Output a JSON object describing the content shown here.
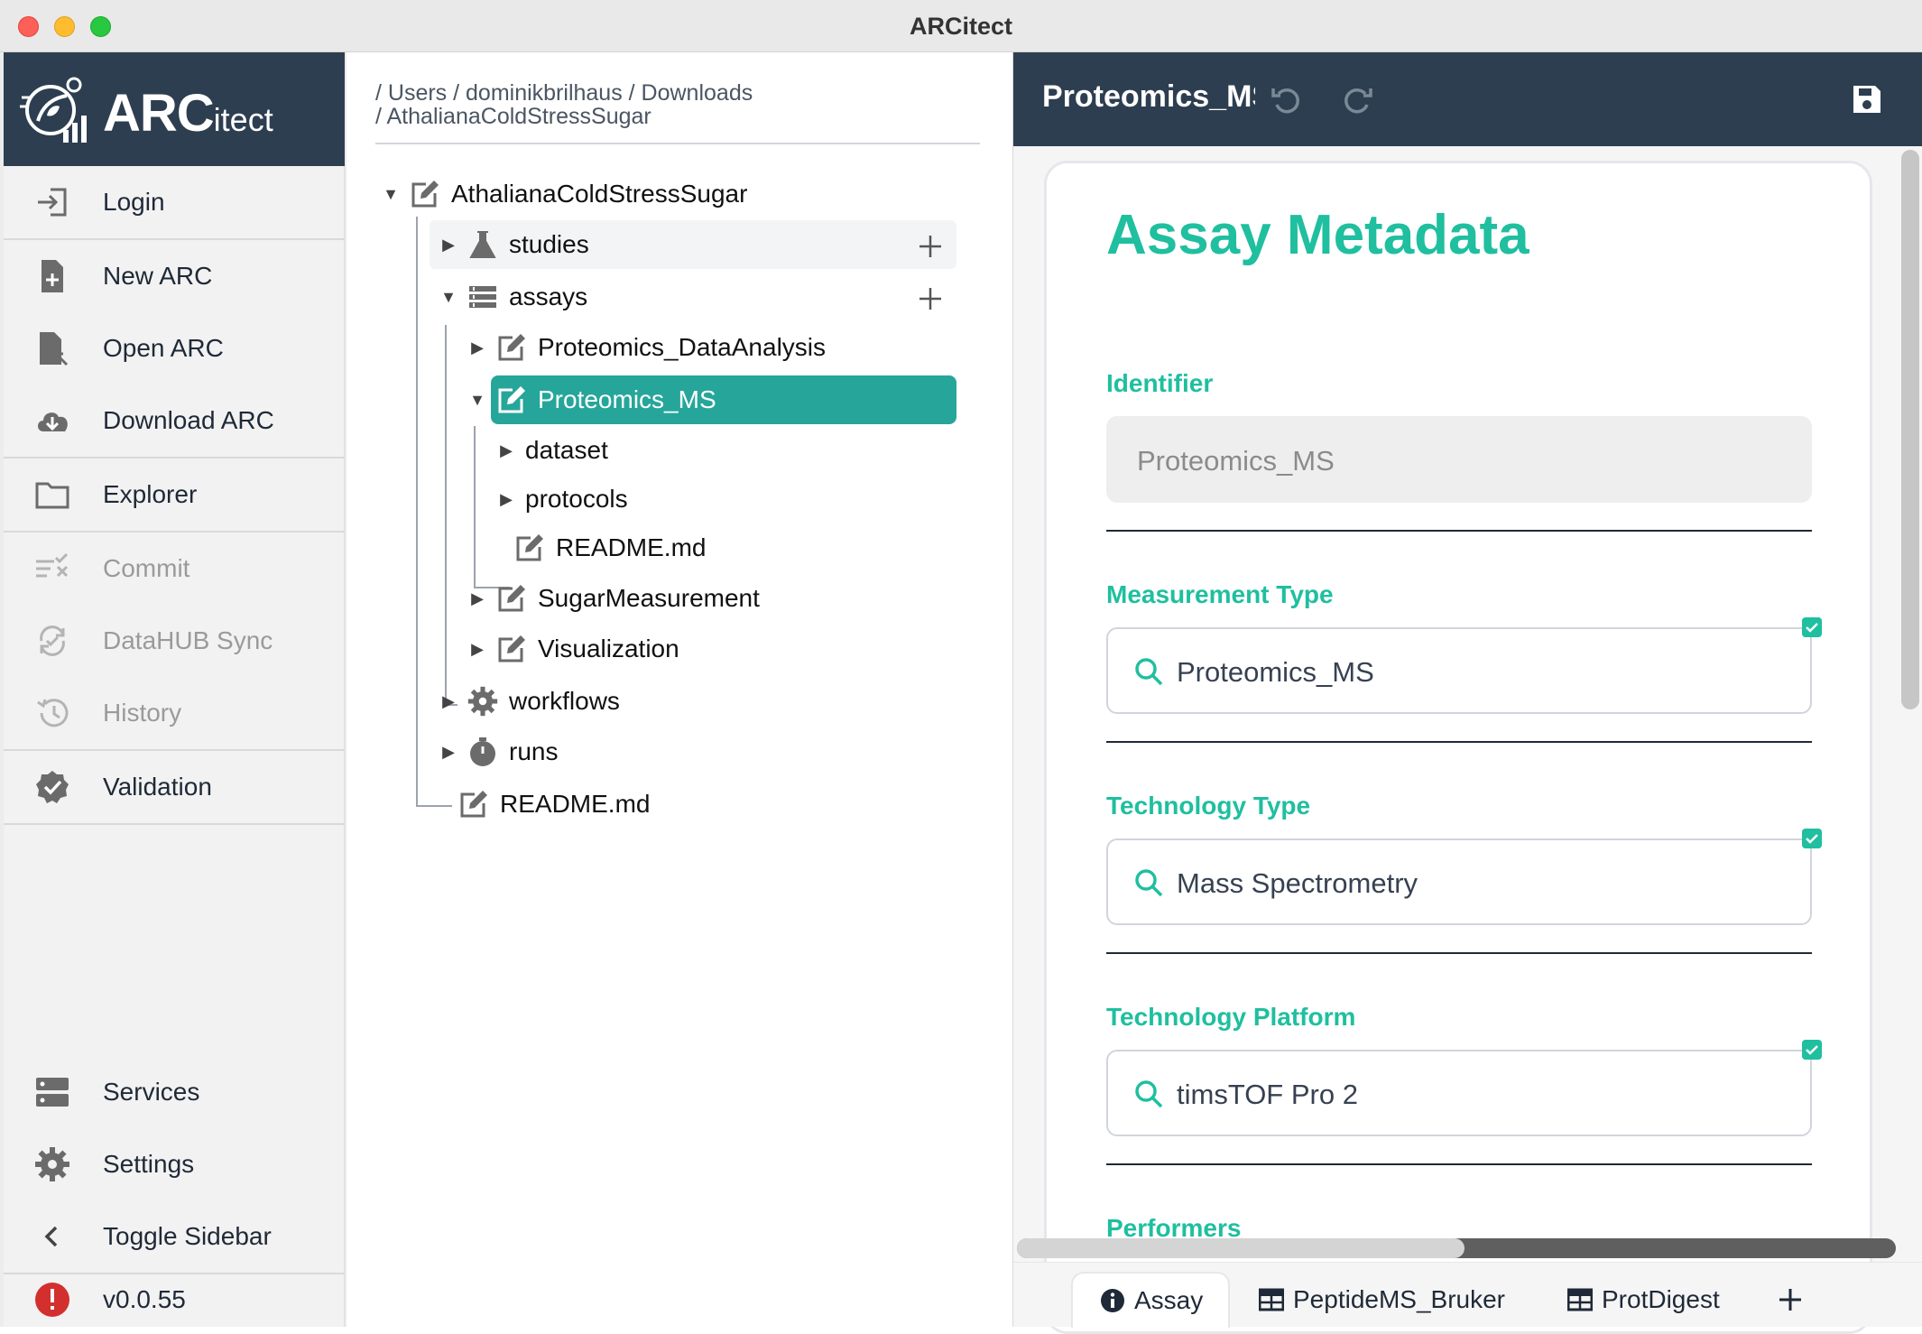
{
  "window": {
    "title": "ARCitect"
  },
  "brand": {
    "name_main": "ARC",
    "name_suffix": "itect"
  },
  "sidebar": {
    "items": [
      {
        "label": "Login",
        "icon": "login-icon",
        "enabled": true
      },
      {
        "label": "New ARC",
        "icon": "new-file-icon",
        "enabled": true
      },
      {
        "label": "Open ARC",
        "icon": "open-file-icon",
        "enabled": true
      },
      {
        "label": "Download ARC",
        "icon": "cloud-download-icon",
        "enabled": true
      },
      {
        "label": "Explorer",
        "icon": "folder-icon",
        "enabled": true
      },
      {
        "label": "Commit",
        "icon": "commit-icon",
        "enabled": false
      },
      {
        "label": "DataHUB Sync",
        "icon": "sync-icon",
        "enabled": false
      },
      {
        "label": "History",
        "icon": "history-icon",
        "enabled": false
      },
      {
        "label": "Validation",
        "icon": "validation-badge-icon",
        "enabled": true
      }
    ],
    "bottom": [
      {
        "label": "Services",
        "icon": "server-icon"
      },
      {
        "label": "Settings",
        "icon": "gear-icon"
      },
      {
        "label": "Toggle Sidebar",
        "icon": "chevron-left-icon"
      }
    ],
    "version": "v0.0.55"
  },
  "explorer": {
    "path_line1": "/ Users / dominikbrilhaus / Downloads",
    "path_line2": "/ AthalianaColdStressSugar",
    "tree": {
      "root": "AthalianaColdStressSugar",
      "studies": "studies",
      "assays": "assays",
      "assay_1": "Proteomics_DataAnalysis",
      "assay_2": "Proteomics_MS",
      "dataset": "dataset",
      "protocols": "protocols",
      "readme_assay": "README.md",
      "assay_3": "SugarMeasurement",
      "assay_4": "Visualization",
      "workflows": "workflows",
      "runs": "runs",
      "readme_root": "README.md"
    }
  },
  "editor": {
    "title": "Proteomics_MS",
    "section_title": "Assay Metadata",
    "fields": {
      "identifier": {
        "label": "Identifier",
        "value": "Proteomics_MS"
      },
      "measurement_type": {
        "label": "Measurement Type",
        "value": "Proteomics_MS"
      },
      "technology_type": {
        "label": "Technology Type",
        "value": "Mass Spectrometry"
      },
      "technology_platform": {
        "label": "Technology Platform",
        "value": "timsTOF Pro 2"
      },
      "performers": {
        "label": "Performers"
      }
    },
    "tabs": [
      {
        "label": "Assay",
        "icon": "info-icon",
        "active": true
      },
      {
        "label": "PeptideMS_Bruker",
        "icon": "table-icon",
        "active": false
      },
      {
        "label": "ProtDigest",
        "icon": "table-icon",
        "active": false
      }
    ]
  },
  "colors": {
    "header_bg": "#2d3e50",
    "accent": "#1fbf9f",
    "selected_row": "#26a69a",
    "error": "#d32f2f"
  }
}
